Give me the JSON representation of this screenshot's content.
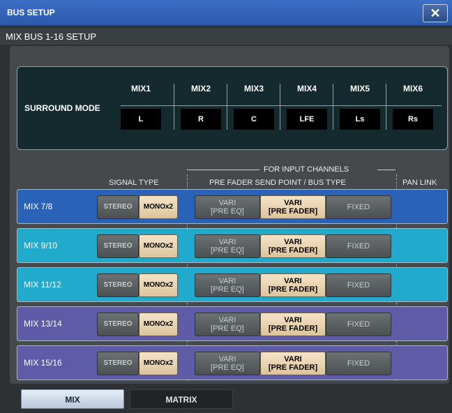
{
  "window": {
    "title": "BUS SETUP",
    "close_label": "✕"
  },
  "subheader": {
    "title": "MIX BUS 1-16 SETUP"
  },
  "surround": {
    "label": "SURROUND MODE",
    "columns": [
      {
        "mix": "MIX1",
        "channel": "L"
      },
      {
        "mix": "MIX2",
        "channel": "R"
      },
      {
        "mix": "MIX3",
        "channel": "C"
      },
      {
        "mix": "MIX4",
        "channel": "LFE"
      },
      {
        "mix": "MIX5",
        "channel": "Ls"
      },
      {
        "mix": "MIX6",
        "channel": "Rs"
      }
    ]
  },
  "headers": {
    "signal_type": "SIGNAL TYPE",
    "for_input": "FOR INPUT CHANNELS",
    "pre_fader": "PRE FADER SEND POINT / BUS TYPE",
    "pan_link": "PAN LINK"
  },
  "buttons": {
    "stereo": "STEREO",
    "mono": "MONOx2",
    "vari_top": "VARI",
    "vari_pre_eq": "[PRE EQ]",
    "vari_pre_fader": "[PRE FADER]",
    "fixed": "FIXED"
  },
  "rows": [
    {
      "label": "MIX 7/8",
      "color": "#2a62b8",
      "signal_type": "MONOx2",
      "send_point": "VARI [PRE FADER]"
    },
    {
      "label": "MIX 9/10",
      "color": "#22aacc",
      "signal_type": "MONOx2",
      "send_point": "VARI [PRE FADER]"
    },
    {
      "label": "MIX 11/12",
      "color": "#22aacc",
      "signal_type": "MONOx2",
      "send_point": "VARI [PRE FADER]"
    },
    {
      "label": "MIX 13/14",
      "color": "#5e5ca6",
      "signal_type": "MONOx2",
      "send_point": "VARI [PRE FADER]"
    },
    {
      "label": "MIX 15/16",
      "color": "#5e5ca6",
      "signal_type": "MONOx2",
      "send_point": "VARI [PRE FADER]"
    }
  ],
  "tabs": [
    {
      "label": "MIX",
      "active": true
    },
    {
      "label": "MATRIX",
      "active": false
    }
  ]
}
